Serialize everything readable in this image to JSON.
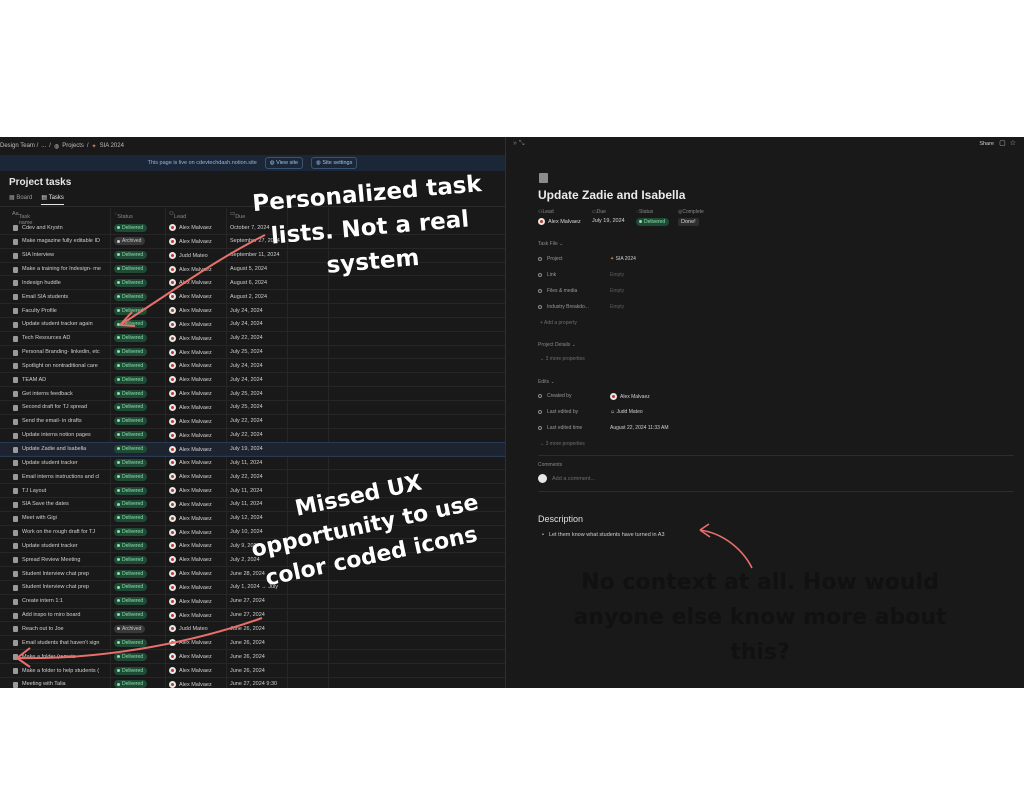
{
  "breadcrumb": [
    "Design Team /",
    "...",
    "/",
    "Projects",
    "/",
    "SIA 2024"
  ],
  "banner": {
    "text": "This page is live on cdevtechdash.notion.site",
    "view_site": "View site",
    "site_settings": "Site settings"
  },
  "project": {
    "title": "Project tasks",
    "tabs": [
      "Board",
      "Tasks"
    ],
    "columns": [
      "Task name",
      "Status",
      "Lead",
      "Due"
    ]
  },
  "rows": [
    {
      "name": "Cdev and Krystn",
      "status": "Delivered",
      "lead": "Alex Malvaez",
      "due": "October 7, 2024"
    },
    {
      "name": "Make magazine fully editable ID",
      "status": "Archived",
      "lead": "Alex Malvaez",
      "due": "September 27, 2024"
    },
    {
      "name": "SIA Interview",
      "status": "Delivered",
      "lead": "Judd Mateo",
      "due": "September 11, 2024"
    },
    {
      "name": "Make a training for Indesign- me",
      "status": "Delivered",
      "lead": "Alex Malvaez",
      "due": "August 5, 2024"
    },
    {
      "name": "Indesign huddle",
      "status": "Delivered",
      "lead": "Alex Malvaez",
      "due": "August 6, 2024"
    },
    {
      "name": "Email SIA students",
      "status": "Delivered",
      "lead": "Alex Malvaez",
      "due": "August 2, 2024"
    },
    {
      "name": "Faculty Profile",
      "status": "Delivered",
      "lead": "Alex Malvaez",
      "due": "July 24, 2024"
    },
    {
      "name": "Update student tracker again",
      "status": "Delivered",
      "lead": "Alex Malvaez",
      "due": "July 24, 2024"
    },
    {
      "name": "Tech Resources AD",
      "status": "Delivered",
      "lead": "Alex Malvaez",
      "due": "July 22, 2024"
    },
    {
      "name": "Personal Branding- linkedin, etc",
      "status": "Delivered",
      "lead": "Alex Malvaez",
      "due": "July 25, 2024"
    },
    {
      "name": "Spotlight on nontraditional care",
      "status": "Delivered",
      "lead": "Alex Malvaez",
      "due": "July 24, 2024"
    },
    {
      "name": "TEAM AD",
      "status": "Delivered",
      "lead": "Alex Malvaez",
      "due": "July 24, 2024"
    },
    {
      "name": "Get interns feedback",
      "status": "Delivered",
      "lead": "Alex Malvaez",
      "due": "July 25, 2024"
    },
    {
      "name": "Second draft for TJ spread",
      "status": "Delivered",
      "lead": "Alex Malvaez",
      "due": "July 25, 2024"
    },
    {
      "name": "Send the email- in drafts",
      "status": "Delivered",
      "lead": "Alex Malvaez",
      "due": "July 22, 2024"
    },
    {
      "name": "Update interns notion pages",
      "status": "Delivered",
      "lead": "Alex Malvaez",
      "due": "July 22, 2024"
    },
    {
      "name": "Update Zadie and Isabella",
      "status": "Delivered",
      "lead": "Alex Malvaez",
      "due": "July 19, 2024"
    },
    {
      "name": "Update student tracker",
      "status": "Delivered",
      "lead": "Alex Malvaez",
      "due": "July 11, 2024"
    },
    {
      "name": "Email interns instructions and cl",
      "status": "Delivered",
      "lead": "Alex Malvaez",
      "due": "July 22, 2024"
    },
    {
      "name": "TJ Layout",
      "status": "Delivered",
      "lead": "Alex Malvaez",
      "due": "July 11, 2024"
    },
    {
      "name": "SIA Save the dates",
      "status": "Delivered",
      "lead": "Alex Malvaez",
      "due": "July 11, 2024"
    },
    {
      "name": "Meet with Gigi",
      "status": "Delivered",
      "lead": "Alex Malvaez",
      "due": "July 12, 2024"
    },
    {
      "name": "Work on the rough draft for TJ",
      "status": "Delivered",
      "lead": "Alex Malvaez",
      "due": "July 10, 2024"
    },
    {
      "name": "Update student tracker",
      "status": "Delivered",
      "lead": "Alex Malvaez",
      "due": "July 9, 2024"
    },
    {
      "name": "Spread Review Meeting",
      "status": "Delivered",
      "lead": "Alex Malvaez",
      "due": "July 2, 2024"
    },
    {
      "name": "Student Interview chat prep",
      "status": "Delivered",
      "lead": "Alex Malvaez",
      "due": "June 28, 2024"
    },
    {
      "name": "Student Interview chat prep",
      "status": "Delivered",
      "lead": "Alex Malvaez",
      "due": "July 1, 2024 → July"
    },
    {
      "name": "Create intern 1:1",
      "status": "Delivered",
      "lead": "Alex Malvaez",
      "due": "June 27, 2024"
    },
    {
      "name": "Add inspo to miro board",
      "status": "Delivered",
      "lead": "Alex Malvaez",
      "due": "June 27, 2024"
    },
    {
      "name": "Reach out to Joe",
      "status": "Archived",
      "lead": "Judd Mateo",
      "due": "June 26, 2024"
    },
    {
      "name": "Email students that haven't sign",
      "status": "Delivered",
      "lead": "Alex Malvaez",
      "due": "June 26, 2024"
    },
    {
      "name": "Make a folder (remote",
      "status": "Delivered",
      "lead": "Alex Malvaez",
      "due": "June 26, 2024"
    },
    {
      "name": "Make a folder to help students (",
      "status": "Delivered",
      "lead": "Alex Malvaez",
      "due": "June 26, 2024"
    },
    {
      "name": "Meeting with Talia",
      "status": "Delivered",
      "lead": "Alex Malvaez",
      "due": "June 27, 2024 9:30"
    }
  ],
  "detail": {
    "share": "Share",
    "title": "Update Zadie and Isabella",
    "prop_labels": [
      "Lead",
      "Due",
      "Status",
      "Complete"
    ],
    "lead": "Alex Malvaez",
    "due": "July 19, 2024",
    "status": "Delivered",
    "complete": "Done!",
    "task_file_label": "Task File",
    "task_file": [
      {
        "key": "Project",
        "value": "SIA 2024"
      },
      {
        "key": "Link",
        "value": "Empty"
      },
      {
        "key": "Files & media",
        "value": "Empty"
      },
      {
        "key": "Industry Breakdo...",
        "value": "Empty"
      }
    ],
    "add_property": "+ Add a property",
    "project_details_label": "Project Details",
    "more_props_1": "3 more properties",
    "edits_label": "Edits",
    "edits": [
      {
        "key": "Created by",
        "value": "Alex Malvaez"
      },
      {
        "key": "Last edited by",
        "value": "Judd Mateo"
      },
      {
        "key": "Last edited time",
        "value": "August 22, 2024 11:33 AM"
      }
    ],
    "more_props_2": "3 more properties",
    "comments_label": "Comments",
    "comment_placeholder": "Add a comment...",
    "description_title": "Description",
    "description_bullet": "Let them know what students have turned in A3"
  },
  "annotations": {
    "a1": "Personalized task lists. Not a real system",
    "a2": "Missed UX opportunity to use color coded icons",
    "a3": "No context at all. How would anyone else know more about this?"
  },
  "colors": {
    "delivered": "#1f4a35",
    "archived": "#383838",
    "arrow": "#e8706a"
  }
}
